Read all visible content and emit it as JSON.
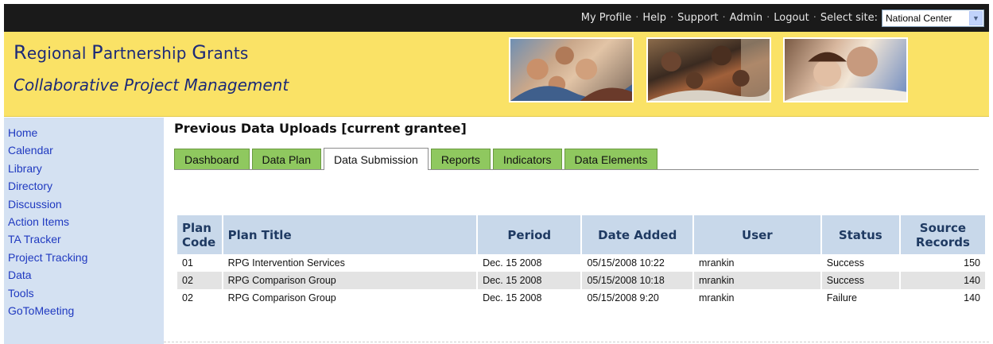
{
  "topbar": {
    "links": [
      "My Profile",
      "Help",
      "Support",
      "Admin",
      "Logout"
    ],
    "separator": "·",
    "select_site_label": "Select site:",
    "site_value": "National Center"
  },
  "header": {
    "title_caps": [
      "R",
      "P",
      "G"
    ],
    "title_rest": [
      "egional ",
      "artnership ",
      "rants"
    ],
    "subtitle": "Collaborative Project Management"
  },
  "sidebar": {
    "items": [
      "Home",
      "Calendar",
      "Library",
      "Directory",
      "Discussion",
      "Action Items",
      "TA Tracker",
      "Project Tracking",
      "Data",
      "Tools",
      "GoToMeeting"
    ]
  },
  "main": {
    "title": "Previous Data Uploads [current grantee]",
    "tabs": [
      {
        "label": "Dashboard",
        "active": false
      },
      {
        "label": "Data Plan",
        "active": false
      },
      {
        "label": "Data Submission",
        "active": true
      },
      {
        "label": "Reports",
        "active": false
      },
      {
        "label": "Indicators",
        "active": false
      },
      {
        "label": "Data Elements",
        "active": false
      }
    ],
    "table": {
      "headers": {
        "plan_code": [
          "Plan",
          "Code"
        ],
        "plan_title": "Plan Title",
        "period": "Period",
        "date_added": "Date Added",
        "user": "User",
        "status": "Status",
        "source_records": [
          "Source",
          "Records"
        ]
      },
      "rows": [
        {
          "code": "01",
          "title": "RPG Intervention Services",
          "period": "Dec. 15 2008",
          "date": "05/15/2008 10:22",
          "user": "mrankin",
          "status": "Success",
          "records": "150"
        },
        {
          "code": "02",
          "title": "RPG Comparison Group",
          "period": "Dec. 15 2008",
          "date": "05/15/2008 10:18",
          "user": "mrankin",
          "status": "Success",
          "records": "140"
        },
        {
          "code": "02",
          "title": "RPG Comparison Group",
          "period": "Dec. 15 2008",
          "date": "05/15/2008 9:20",
          "user": "mrankin",
          "status": "Failure",
          "records": "140"
        }
      ]
    }
  },
  "colors": {
    "topbar_bg": "#1a1a1a",
    "header_bg": "#fae266",
    "brand_text": "#1c2a78",
    "sidebar_bg": "#d4e1f2",
    "link": "#1f39c0",
    "tab_green": "#8fc85f",
    "table_header_bg": "#c8d8ea",
    "row_alt_bg": "#e3e3e3"
  }
}
